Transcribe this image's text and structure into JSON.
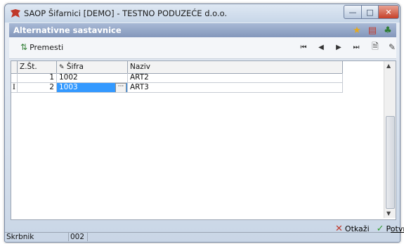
{
  "window": {
    "title": "SAOP Šifarnici [DEMO] - TESTNO PODUZEĆE d.o.o.",
    "minimize_symbol": "—",
    "maximize_symbol": "□",
    "close_symbol": "✕"
  },
  "panel": {
    "title": "Alternativne sastavnice",
    "icons": [
      "star-icon",
      "document-pdf-icon",
      "tree-icon"
    ]
  },
  "toolbar": {
    "premesti_label": "Premesti",
    "nav": [
      "first-record-icon",
      "previous-record-icon",
      "next-record-icon",
      "last-record-icon"
    ],
    "actions": [
      "new-record-icon",
      "edit-record-icon"
    ]
  },
  "grid": {
    "columns": [
      "Z.Št.",
      "Šifra",
      "Naziv"
    ],
    "rows": [
      {
        "zst": "1",
        "sifra": "1002",
        "naziv": "ART2",
        "selected": false
      },
      {
        "zst": "2",
        "sifra": "1003",
        "naziv": "ART3",
        "selected": true
      }
    ],
    "row_indicator": "I"
  },
  "footer": {
    "cancel_label": "Otkaži",
    "confirm_label": "Potvrdi"
  },
  "status": {
    "label": "Skrbnik",
    "value": "002"
  },
  "colors": {
    "panel_header": "#8397bb",
    "selection": "#3399ff",
    "cancel_red": "#c0392b",
    "confirm_green": "#2e9b2e"
  }
}
